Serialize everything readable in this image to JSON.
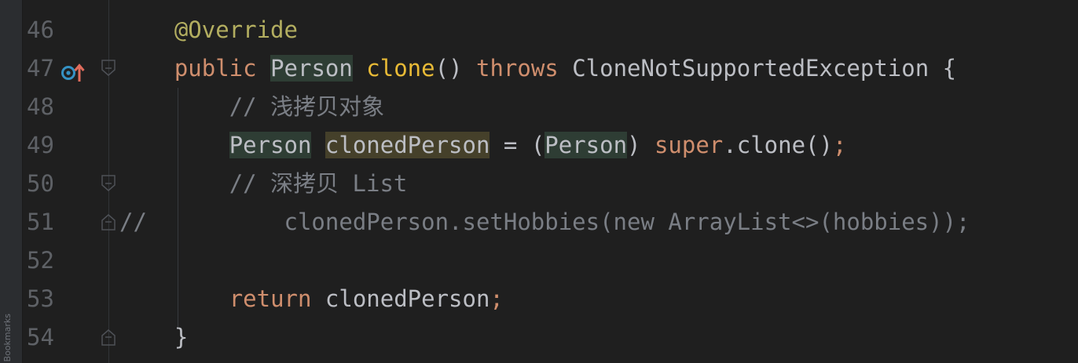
{
  "side_panel": {
    "bookmarks_label": "Bookmarks"
  },
  "lines": [
    {
      "number": "46",
      "tokens": [
        {
          "t": "    ",
          "c": "plain"
        },
        {
          "t": "@Override",
          "c": "ann"
        }
      ]
    },
    {
      "number": "47",
      "tokens": [
        {
          "t": "    ",
          "c": "plain"
        },
        {
          "t": "public ",
          "c": "kw"
        },
        {
          "t": "Person",
          "c": "plain cls-hl"
        },
        {
          "t": " ",
          "c": "plain"
        },
        {
          "t": "clone",
          "c": "fnc"
        },
        {
          "t": "() ",
          "c": "plain"
        },
        {
          "t": "throws ",
          "c": "kw"
        },
        {
          "t": "CloneNotSupportedException {",
          "c": "plain"
        }
      ]
    },
    {
      "number": "48",
      "tokens": [
        {
          "t": "        ",
          "c": "plain"
        },
        {
          "t": "// 浅拷贝对象",
          "c": "cm"
        }
      ]
    },
    {
      "number": "49",
      "tokens": [
        {
          "t": "        ",
          "c": "plain"
        },
        {
          "t": "Person",
          "c": "plain cls-hl"
        },
        {
          "t": " ",
          "c": "plain"
        },
        {
          "t": "clonedPerson",
          "c": "plain var-hl"
        },
        {
          "t": " = (",
          "c": "plain"
        },
        {
          "t": "Person",
          "c": "plain cls-hl"
        },
        {
          "t": ") ",
          "c": "plain"
        },
        {
          "t": "super",
          "c": "kw"
        },
        {
          "t": ".clone()",
          "c": "plain"
        },
        {
          "t": ";",
          "c": "kw"
        }
      ]
    },
    {
      "number": "50",
      "tokens": [
        {
          "t": "        ",
          "c": "plain"
        },
        {
          "t": "// 深拷贝 List",
          "c": "cm"
        }
      ]
    },
    {
      "number": "51",
      "tokens": [
        {
          "t": "//",
          "c": "cm"
        },
        {
          "t": "          clonedPerson.setHobbies(new ArrayList<>(hobbies));",
          "c": "cm"
        }
      ]
    },
    {
      "number": "52",
      "tokens": []
    },
    {
      "number": "53",
      "tokens": [
        {
          "t": "        ",
          "c": "plain"
        },
        {
          "t": "return ",
          "c": "kw"
        },
        {
          "t": "clonedPerson",
          "c": "plain"
        },
        {
          "t": ";",
          "c": "kw"
        }
      ]
    },
    {
      "number": "54",
      "tokens": [
        {
          "t": "    ",
          "c": "plain"
        },
        {
          "t": "}",
          "c": "plain"
        }
      ]
    }
  ],
  "gutter_markers": {
    "line_47": "override-method-icon"
  },
  "colors": {
    "background": "#1f1f1f",
    "keyword": "#cf8e6d",
    "annotation": "#b3ae60",
    "method_declaration": "#e8ba36",
    "comment": "#7a7e85",
    "line_number": "#5e6166",
    "marker_blue": "#3592c4",
    "marker_red": "#e06c5c"
  }
}
